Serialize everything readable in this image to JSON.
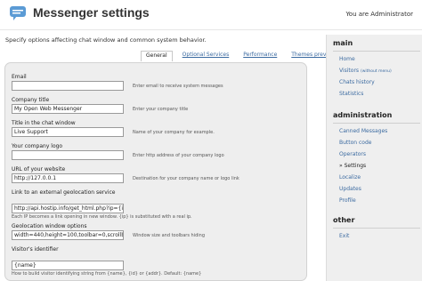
{
  "header": {
    "title": "Messenger settings",
    "user_text": "You are Administrator"
  },
  "subtitle": "Specify options affecting chat window and common system behavior.",
  "tabs": [
    {
      "label": "General",
      "active": true
    },
    {
      "label": "Optional Services",
      "active": false
    },
    {
      "label": "Performance",
      "active": false
    },
    {
      "label": "Themes preview",
      "active": false
    }
  ],
  "form": {
    "email": {
      "label": "Email",
      "value": "",
      "hint": "Enter email to receive system messages"
    },
    "company_title": {
      "label": "Company title",
      "value": "My Open Web Messenger",
      "hint": "Enter your company title"
    },
    "chat_title": {
      "label": "Title in the chat window",
      "value": "Live Support",
      "hint": "Name of your company for example."
    },
    "logo": {
      "label": "Your company logo",
      "value": "",
      "hint": "Enter http address of your company logo"
    },
    "website": {
      "label": "URL of your website",
      "value": "http://127.0.0.1",
      "hint": "Destination for your company name or logo link"
    },
    "geolink": {
      "label": "Link to an external geolocation service",
      "value": "http://api.hostip.info/get_html.php?ip={ip}",
      "hint": "Each IP becomes a link opening in new window. {ip} is substituted with a real ip."
    },
    "geoparams": {
      "label": "Geolocation window options",
      "value": "width=440,height=100,toolbar=0,scrollbars=0",
      "hint": "Window size and toolbars hiding"
    },
    "visitor_id": {
      "label": "Visitor's identifier",
      "value": "{name}",
      "hint": "How to build visitor identifying string from {name}, {id} or {addr}. Default: {name}"
    }
  },
  "sidebar": {
    "main_title": "main",
    "main_items": [
      {
        "label": "Home",
        "note": ""
      },
      {
        "label": "Visitors",
        "note": "(without menu)"
      },
      {
        "label": "Chats history",
        "note": ""
      },
      {
        "label": "Statistics",
        "note": ""
      }
    ],
    "admin_title": "administration",
    "admin_items": [
      {
        "label": "Canned Messages",
        "current": false
      },
      {
        "label": "Button code",
        "current": false
      },
      {
        "label": "Operators",
        "current": false
      },
      {
        "label": "» Settings",
        "current": true
      },
      {
        "label": "Localize",
        "current": false
      },
      {
        "label": "Updates",
        "current": false
      },
      {
        "label": "Profile",
        "current": false
      }
    ],
    "other_title": "other",
    "other_items": [
      {
        "label": "Exit"
      }
    ]
  },
  "colors": {
    "link": "#3b6aa0",
    "panel": "#eeeeee",
    "sidebar": "#efefef",
    "logo": "#5b9bd5"
  },
  "icons": {
    "logo": "chat-bubble-icon"
  }
}
